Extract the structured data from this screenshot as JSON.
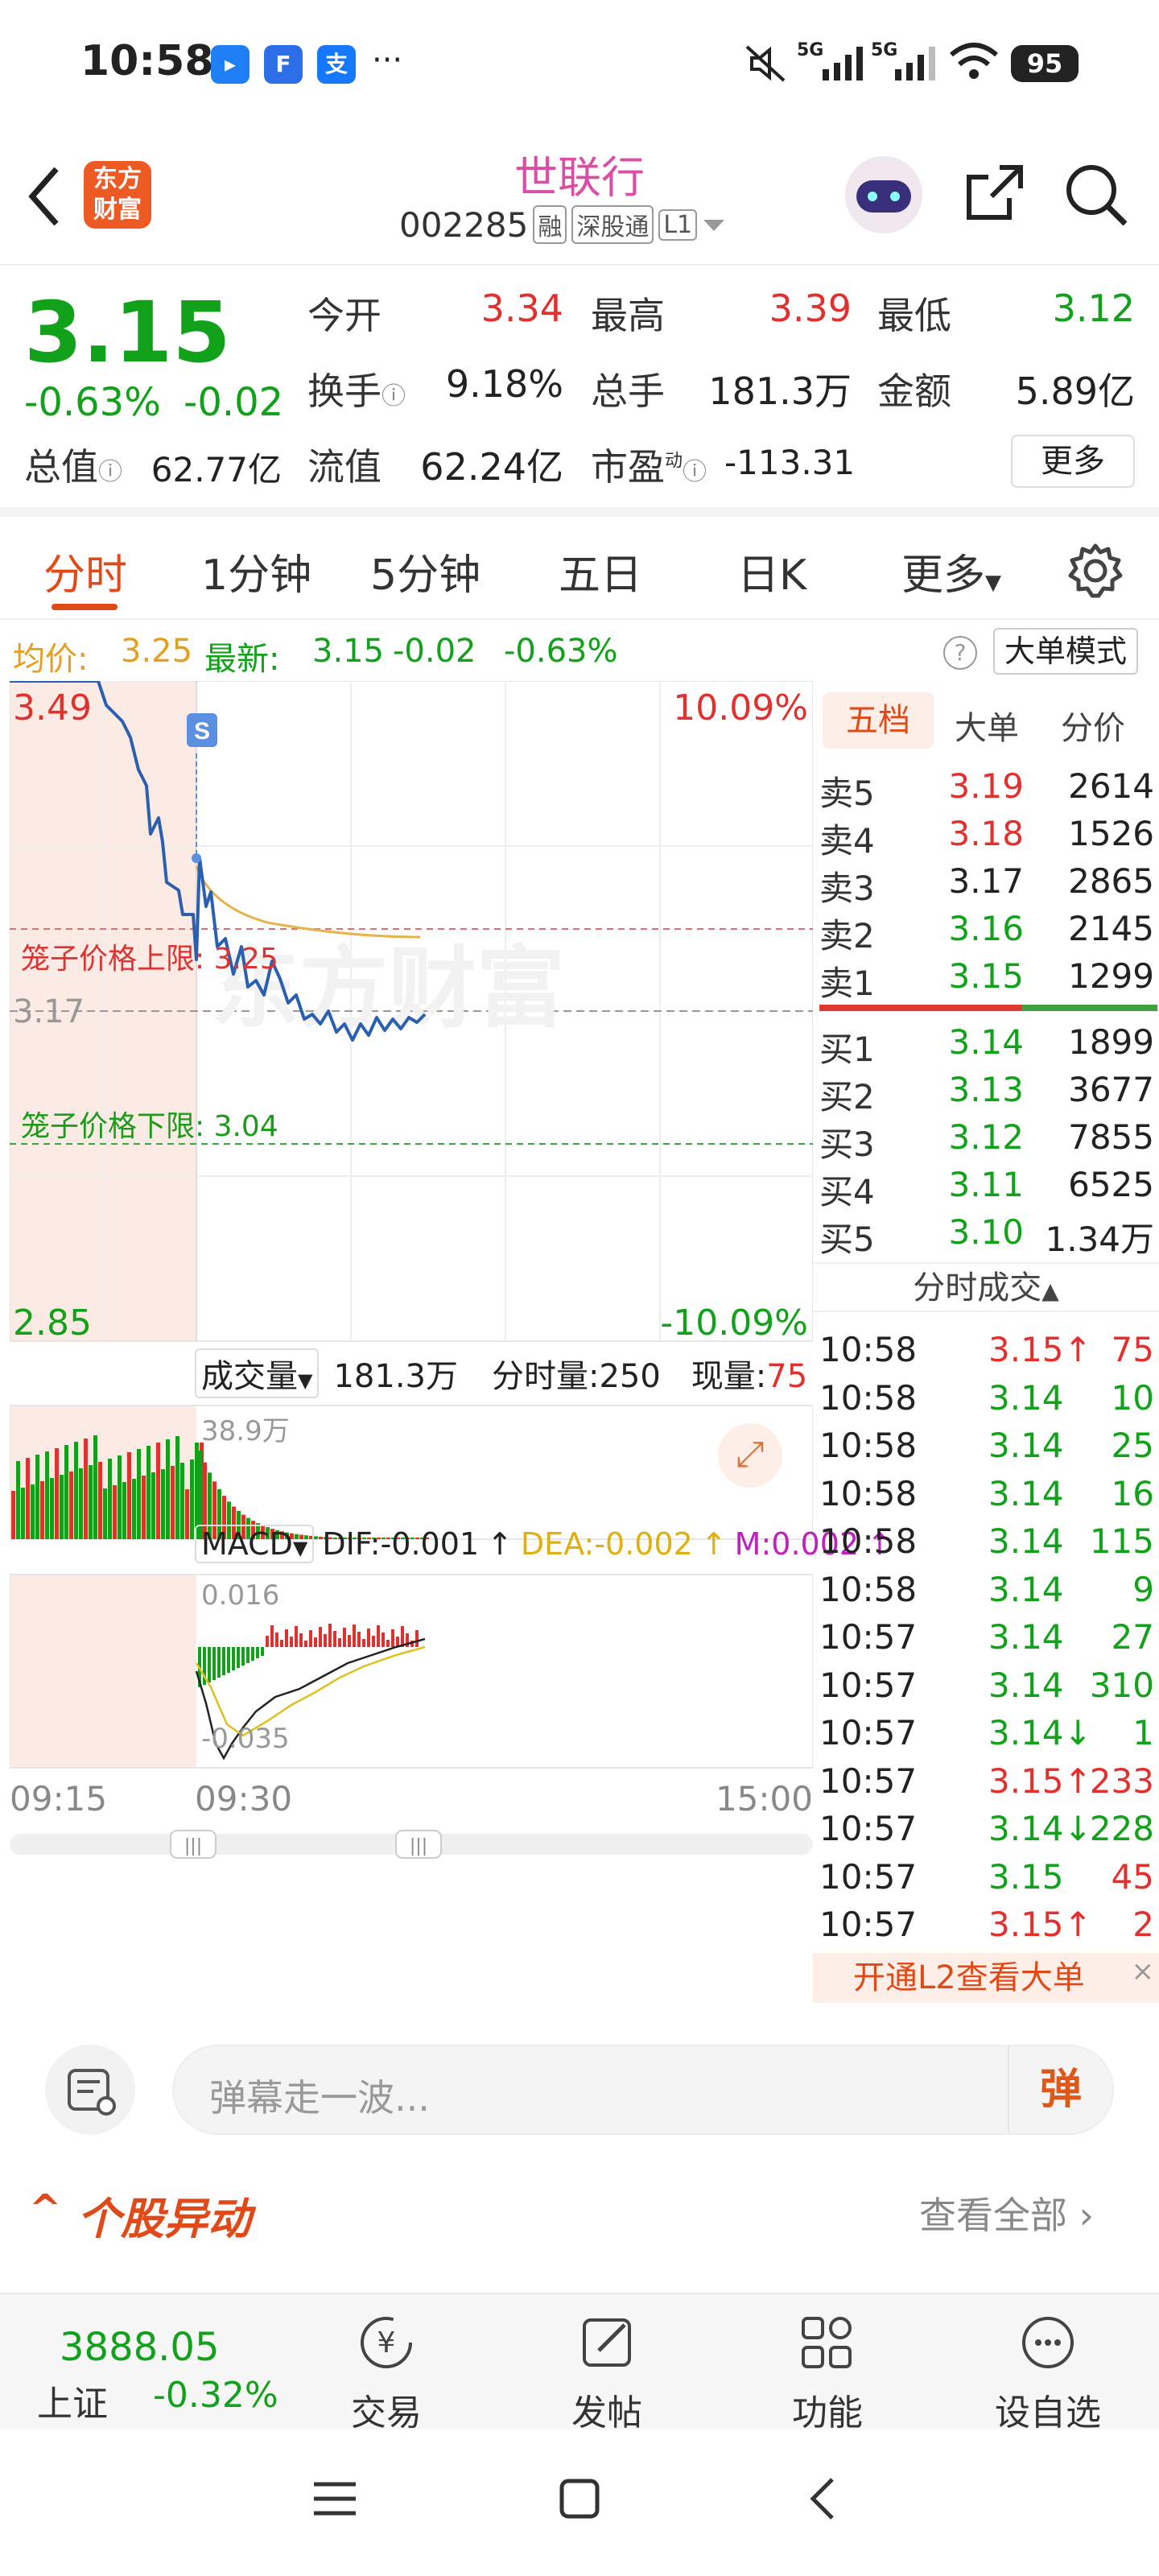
{
  "status_bar": {
    "time": "10:58",
    "dots": "···",
    "signal1": "5G",
    "signal2": "5G",
    "battery": "95"
  },
  "header": {
    "logo_line1": "东方",
    "logo_line2": "财富",
    "stock_name": "世联行",
    "stock_code": "002285",
    "tags": [
      "融",
      "深股通",
      "L1"
    ]
  },
  "quote": {
    "price": "3.15",
    "change_pct": "-0.63%",
    "change": "-0.02",
    "open_label": "今开",
    "open": "3.34",
    "high_label": "最高",
    "high": "3.39",
    "low_label": "最低",
    "low": "3.12",
    "turnover_label": "换手",
    "turnover": "9.18%",
    "volume_label": "总手",
    "volume": "181.3万",
    "amount_label": "金额",
    "amount": "5.89亿",
    "mktcap_label": "总值",
    "mktcap": "62.77亿",
    "float_label": "流值",
    "float_cap": "62.24亿",
    "pe_label": "市盈",
    "pe_sup": "动",
    "pe": "-113.31",
    "more_button": "更多"
  },
  "tabs": {
    "items": [
      "分时",
      "1分钟",
      "5分钟",
      "五日",
      "日K",
      "更多"
    ],
    "active": "分时"
  },
  "info_bar": {
    "avg_label": "均价:",
    "avg": "3.25",
    "latest_label": "最新:",
    "latest": "3.15",
    "chg": "-0.02",
    "chg_pct": "-0.63%",
    "mode_button": "大单模式"
  },
  "chart_labels": {
    "top_price": "3.49",
    "top_pct": "10.09%",
    "mid_price": "3.17",
    "bottom_price": "2.85",
    "bottom_pct": "-10.09%",
    "upper_cage": "笼子价格上限: 3.25",
    "lower_cage": "笼子价格下限: 3.04",
    "signal": "S",
    "watermark": "东方财富",
    "vol_label": "成交量",
    "vol_total": "181.3万",
    "vol_fen": "分时量:250",
    "vol_now_label": "现量:",
    "vol_now": "75",
    "vol_peak": "38.9万",
    "macd_label": "MACD",
    "dif": "DIF:-0.001",
    "dea": "DEA:-0.002",
    "m": "M:0.002",
    "macd_top": "0.016",
    "macd_bottom": "-0.035",
    "time_start": "09:15",
    "time_open": "09:30",
    "time_end": "15:00"
  },
  "depth": {
    "tab_active": "五档",
    "tab2": "大单",
    "tab3": "分价",
    "asks": [
      {
        "label": "卖5",
        "price": "3.19",
        "vol": "2614",
        "color": "red"
      },
      {
        "label": "卖4",
        "price": "3.18",
        "vol": "1526",
        "color": "red"
      },
      {
        "label": "卖3",
        "price": "3.17",
        "vol": "2865",
        "color": "black"
      },
      {
        "label": "卖2",
        "price": "3.16",
        "vol": "2145",
        "color": "green"
      },
      {
        "label": "卖1",
        "price": "3.15",
        "vol": "1299",
        "color": "green"
      }
    ],
    "bids": [
      {
        "label": "买1",
        "price": "3.14",
        "vol": "1899",
        "color": "green"
      },
      {
        "label": "买2",
        "price": "3.13",
        "vol": "3677",
        "color": "green"
      },
      {
        "label": "买3",
        "price": "3.12",
        "vol": "7855",
        "color": "green"
      },
      {
        "label": "买4",
        "price": "3.11",
        "vol": "6525",
        "color": "green"
      },
      {
        "label": "买5",
        "price": "3.10",
        "vol": "1.34万",
        "color": "green"
      }
    ],
    "ticks_title": "分时成交",
    "ticks": [
      {
        "time": "10:58",
        "price": "3.15↑",
        "vol": "75",
        "pc": "red",
        "vc": "red"
      },
      {
        "time": "10:58",
        "price": "3.14",
        "vol": "10",
        "pc": "green",
        "vc": "green"
      },
      {
        "time": "10:58",
        "price": "3.14",
        "vol": "25",
        "pc": "green",
        "vc": "green"
      },
      {
        "time": "10:58",
        "price": "3.14",
        "vol": "16",
        "pc": "green",
        "vc": "green"
      },
      {
        "time": "10:58",
        "price": "3.14",
        "vol": "115",
        "pc": "green",
        "vc": "green"
      },
      {
        "time": "10:58",
        "price": "3.14",
        "vol": "9",
        "pc": "green",
        "vc": "green"
      },
      {
        "time": "10:57",
        "price": "3.14",
        "vol": "27",
        "pc": "green",
        "vc": "green"
      },
      {
        "time": "10:57",
        "price": "3.14",
        "vol": "310",
        "pc": "green",
        "vc": "green"
      },
      {
        "time": "10:57",
        "price": "3.14↓",
        "vol": "1",
        "pc": "green",
        "vc": "green"
      },
      {
        "time": "10:57",
        "price": "3.15↑",
        "vol": "233",
        "pc": "red",
        "vc": "red"
      },
      {
        "time": "10:57",
        "price": "3.14↓",
        "vol": "228",
        "pc": "green",
        "vc": "green"
      },
      {
        "time": "10:57",
        "price": "3.15",
        "vol": "45",
        "pc": "green",
        "vc": "red"
      },
      {
        "time": "10:57",
        "price": "3.15↑",
        "vol": "2",
        "pc": "red",
        "vc": "red"
      }
    ],
    "l2_banner": "开通L2查看大单"
  },
  "comment": {
    "placeholder": "弹幕走一波...",
    "send_label": "弹"
  },
  "alerts": {
    "title": "个股异动",
    "view_all": "查看全部"
  },
  "bottom_nav": {
    "index_value": "3888.05",
    "index_name": "上证",
    "index_chg": "-0.32%",
    "items": [
      "交易",
      "发帖",
      "功能",
      "设自选"
    ]
  }
}
